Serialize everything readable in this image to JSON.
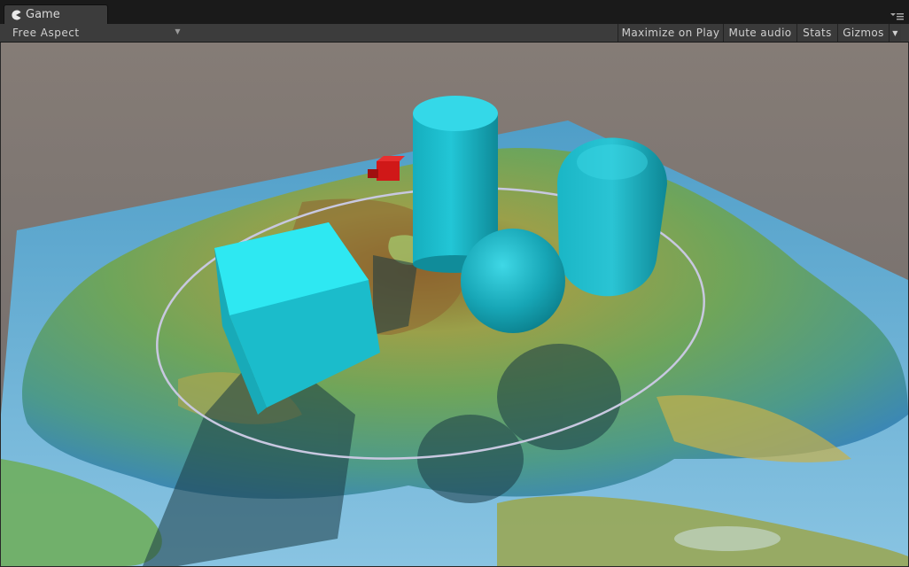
{
  "window": {
    "tab": {
      "label": "Game",
      "icon": "pacman-game-icon"
    },
    "menu_icon": "hamburger-menu-icon"
  },
  "toolbar": {
    "aspect": {
      "label": "Free Aspect",
      "icon": "dropdown-arrow-icon"
    },
    "maximize_label": "Maximize on Play",
    "mute_label": "Mute audio",
    "stats_label": "Stats",
    "gizmos_label": "Gizmos",
    "gizmos_dropdown_icon": "dropdown-arrow-icon"
  },
  "scene": {
    "sky_color": "#7c7572",
    "primitive_color": "#1ec8d8",
    "marker_color": "#d01818",
    "ring_color": "#c8c8e0",
    "objects": [
      "cube",
      "cylinder",
      "sphere",
      "capsule",
      "small-red-cube",
      "selection-ring",
      "terrain-map-plane"
    ]
  }
}
